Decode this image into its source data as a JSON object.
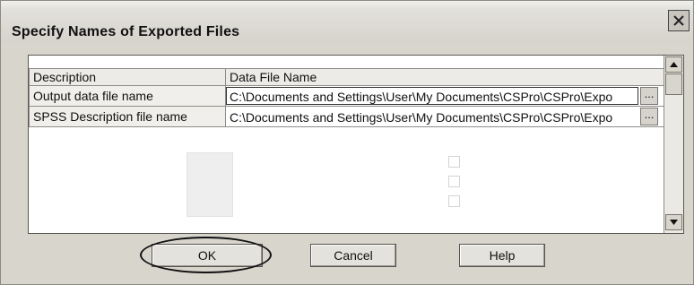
{
  "dialog": {
    "title": "Specify Names of Exported Files",
    "close_label": "×"
  },
  "grid": {
    "headers": [
      "Description",
      "Data File Name"
    ],
    "rows": [
      {
        "description": "Output data file name",
        "file": "C:\\Documents and Settings\\User\\My Documents\\CSPro\\CSPro\\Expo",
        "browse": "..."
      },
      {
        "description": "SPSS Description file name",
        "file": "C:\\Documents and Settings\\User\\My Documents\\CSPro\\CSPro\\Expo",
        "browse": "..."
      }
    ]
  },
  "buttons": {
    "ok": "OK",
    "cancel": "Cancel",
    "help": "Help"
  },
  "icons": {
    "close": "close-icon",
    "scroll_up": "scroll-up-arrow-icon",
    "scroll_down": "scroll-down-arrow-icon"
  },
  "colors": {
    "dialog_bg": "#d8d5cd",
    "grid_bg": "#ffffff",
    "highlight_ring": "#111111"
  }
}
